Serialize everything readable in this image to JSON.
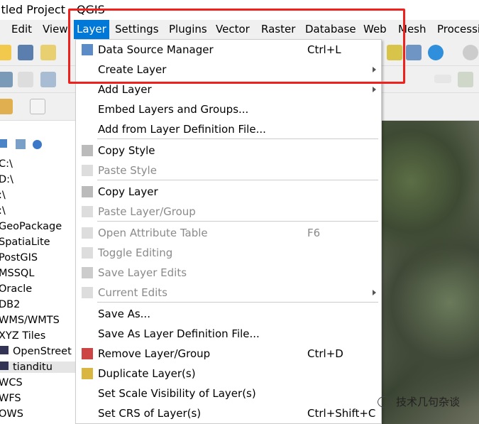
{
  "window": {
    "title": "itled Project - QGIS"
  },
  "menubar": [
    "Edit",
    "View",
    "Layer",
    "Settings",
    "Plugins",
    "Vector",
    "Raster",
    "Database",
    "Web",
    "Mesh",
    "Processi"
  ],
  "active_menu": "Layer",
  "layer_menu": [
    {
      "label": "Data Source Manager",
      "shortcut": "Ctrl+L",
      "icon": "data-source-manager-icon",
      "enabled": true
    },
    {
      "label": "Create Layer",
      "submenu": true,
      "enabled": true
    },
    {
      "label": "Add Layer",
      "submenu": true,
      "enabled": true
    },
    {
      "label": "Embed Layers and Groups...",
      "enabled": true
    },
    {
      "label": "Add from Layer Definition File...",
      "enabled": true
    },
    {
      "label": "Copy Style",
      "icon": "copy-icon",
      "enabled": true
    },
    {
      "label": "Paste Style",
      "icon": "paste-icon",
      "enabled": false
    },
    {
      "label": "Copy Layer",
      "icon": "copy-icon",
      "enabled": true
    },
    {
      "label": "Paste Layer/Group",
      "icon": "paste-icon",
      "enabled": false
    },
    {
      "label": "Open Attribute Table",
      "shortcut": "F6",
      "icon": "table-icon",
      "enabled": false
    },
    {
      "label": "Toggle Editing",
      "icon": "pencil-icon",
      "enabled": false
    },
    {
      "label": "Save Layer Edits",
      "icon": "save-icon",
      "enabled": false
    },
    {
      "label": "Current Edits",
      "submenu": true,
      "icon": "pencil-icon",
      "enabled": false
    },
    {
      "label": "Save As...",
      "enabled": true
    },
    {
      "label": "Save As Layer Definition File...",
      "enabled": true
    },
    {
      "label": "Remove Layer/Group",
      "shortcut": "Ctrl+D",
      "icon": "remove-layer-icon",
      "enabled": true
    },
    {
      "label": "Duplicate Layer(s)",
      "icon": "duplicate-icon",
      "enabled": true
    },
    {
      "label": "Set Scale Visibility of Layer(s)",
      "enabled": true
    },
    {
      "label": "Set CRS of Layer(s)",
      "shortcut": "Ctrl+Shift+C",
      "enabled": true
    }
  ],
  "browser_items": [
    "C:\\",
    "D:\\",
    ":\\",
    ":\\",
    "GeoPackage",
    "SpatiaLite",
    "PostGIS",
    "MSSQL",
    "Oracle",
    "DB2",
    "WMS/WMTS",
    "XYZ Tiles",
    "OpenStreet",
    "tianditu",
    "WCS",
    "WFS",
    "OWS"
  ],
  "watermark": "技术几句杂谈",
  "colors": {
    "highlight": "#0078d7",
    "annotation_box": "#f0201c"
  }
}
